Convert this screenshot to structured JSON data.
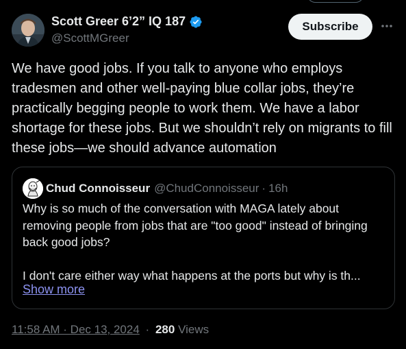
{
  "post": {
    "author": {
      "display_name": "Scott Greer 6’2” IQ 187",
      "handle": "@ScottMGreer",
      "verified": true,
      "verified_icon": "verified-badge-icon",
      "verified_color": "#1d9bf0"
    },
    "subscribe_label": "Subscribe",
    "more_icon": "more-horizontal-icon",
    "text": "We have good jobs. If you talk to anyone who employs tradesmen and other well-paying blue collar jobs, they’re practically begging people to work them. We have a labor shortage for these jobs. But we shouldn’t rely on migrants to fill these jobs—we should advance automation",
    "quote": {
      "display_name": "Chud Connoisseur",
      "handle": "@ChudConnoisseur",
      "separator": "·",
      "time": "16h",
      "text": "Why is so much of the conversation with MAGA lately about removing people from jobs that are \"too good\" instead of bringing back good jobs?\n\nI don't care either way what happens at the ports but why is th...",
      "show_more_label": "Show more"
    },
    "timestamp": "11:58 AM · Dec 13, 2024",
    "meta_separator": "·",
    "views_count": "280",
    "views_label": "Views"
  },
  "colors": {
    "background": "#000000",
    "primary_text": "#e7e9ea",
    "secondary_text": "#71767b",
    "link": "#8c92f0",
    "border": "#2f3336",
    "subscribe_bg": "#eff3f4",
    "subscribe_text": "#0f1419"
  }
}
